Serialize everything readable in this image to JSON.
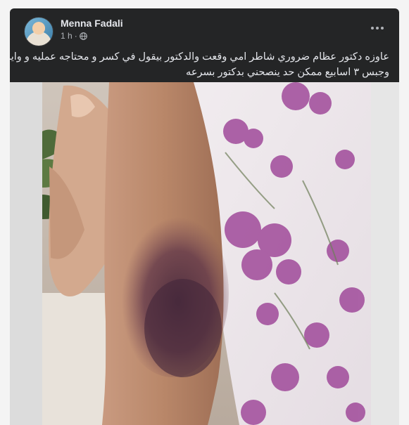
{
  "post": {
    "author": "Menna Fadali",
    "time": "1 h",
    "separator": "·",
    "privacy_icon": "globe-icon",
    "more_icon": "more-options-icon",
    "text_line_1": "عاوزه دكتور عظام ضروري شاطر امي وقعت والدكتور بيقول في كسر و محتاجه عمليه و واير",
    "text_line_2": "وجبس ٣ اسابيع ممكن حد ينصحني بدكتور بسرعه"
  },
  "photo": {
    "description_icon": "bruised-arm-photo"
  },
  "colors": {
    "card_bg": "#242526",
    "text_primary": "#e4e6eb",
    "text_secondary": "#b0b3b8"
  }
}
